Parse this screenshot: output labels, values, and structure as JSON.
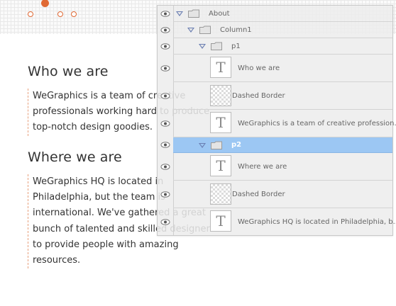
{
  "page": {
    "pagination_dots": [
      false,
      true,
      false,
      false
    ],
    "accent_color": "#e06a35",
    "sections": [
      {
        "heading": "Who we are",
        "lines": [
          "WeGraphics is a team of creative",
          "professionals working hard to produce",
          "top-notch design goodies."
        ]
      },
      {
        "heading": "Where we are",
        "lines": [
          "WeGraphics HQ is located in",
          "Philadelphia, but the team is",
          "international. We've gathered a great",
          "bunch of talented and skilled designers",
          "to provide people with amazing",
          "resources."
        ]
      }
    ]
  },
  "layers_panel": {
    "selection_color": "#9cc7f3",
    "layers": [
      {
        "type": "group",
        "label": "About",
        "level": 0,
        "expanded": true,
        "selected": false
      },
      {
        "type": "group",
        "label": "Column1",
        "level": 1,
        "expanded": true,
        "selected": false
      },
      {
        "type": "group",
        "label": "p1",
        "level": 2,
        "expanded": true,
        "selected": false
      },
      {
        "type": "text",
        "thumb": "T",
        "label": "Who we are",
        "selected": false
      },
      {
        "type": "shape",
        "label": "Dashed Border",
        "selected": false
      },
      {
        "type": "text",
        "thumb": "T",
        "label": "WeGraphics is a team of creative profession...",
        "selected": false
      },
      {
        "type": "group",
        "label": "p2",
        "level": 2,
        "expanded": true,
        "selected": true
      },
      {
        "type": "text",
        "thumb": "T",
        "label": "Where we are",
        "selected": false
      },
      {
        "type": "shape",
        "label": "Dashed Border",
        "selected": false
      },
      {
        "type": "text",
        "thumb": "T",
        "label": "WeGraphics HQ is located in Philadelphia, b...",
        "selected": false
      }
    ]
  }
}
